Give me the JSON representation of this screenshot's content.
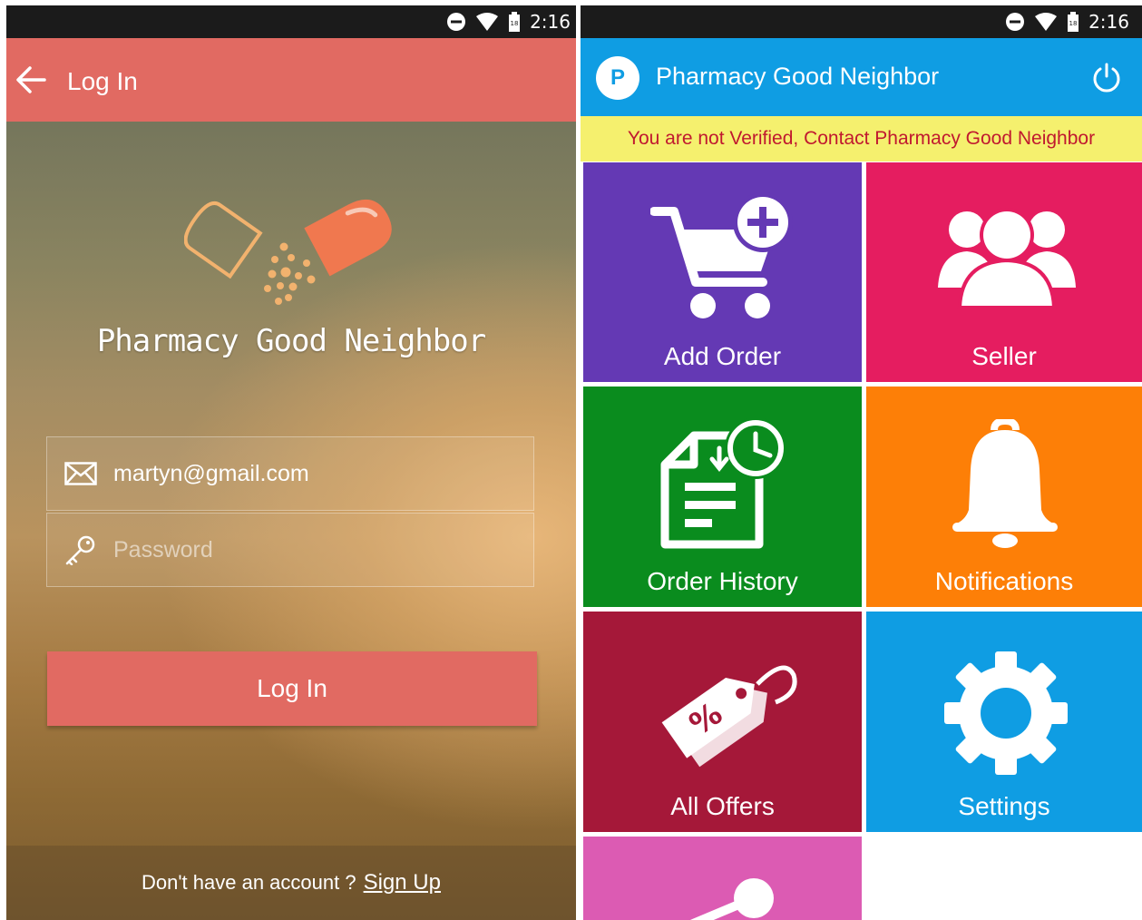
{
  "status_bar": {
    "time": "2:16"
  },
  "login_screen": {
    "app_bar": {
      "title": "Log In"
    },
    "brand_name": "Pharmacy Good Neighbor",
    "email": {
      "value": "martyn@gmail.com"
    },
    "password": {
      "placeholder": "Password"
    },
    "login_button": "Log In",
    "footer": {
      "prompt": "Don't have an account ?",
      "link": "Sign Up"
    }
  },
  "dashboard": {
    "app_bar": {
      "avatar_letter": "P",
      "title": "Pharmacy Good Neighbor"
    },
    "banner": "You are not Verified, Contact Pharmacy Good Neighbor",
    "tiles": [
      {
        "label": "Add Order",
        "icon": "cart-plus-icon",
        "color": "#6439b4"
      },
      {
        "label": "Seller",
        "icon": "users-icon",
        "color": "#e51d60"
      },
      {
        "label": "Order History",
        "icon": "document-clock-icon",
        "color": "#0a8c1e"
      },
      {
        "label": "Notifications",
        "icon": "bell-icon",
        "color": "#fd7f07"
      },
      {
        "label": "All Offers",
        "icon": "discount-tag-icon",
        "color": "#a51839"
      },
      {
        "label": "Settings",
        "icon": "gear-icon",
        "color": "#0f9de3"
      },
      {
        "label": "",
        "icon": "share-icon",
        "color": "#dc5bb3"
      }
    ]
  },
  "colors": {
    "login_accent": "#e16a62",
    "dashboard_accent": "#0f9de3",
    "banner_bg": "#f5f06e",
    "banner_text": "#c0182f"
  }
}
